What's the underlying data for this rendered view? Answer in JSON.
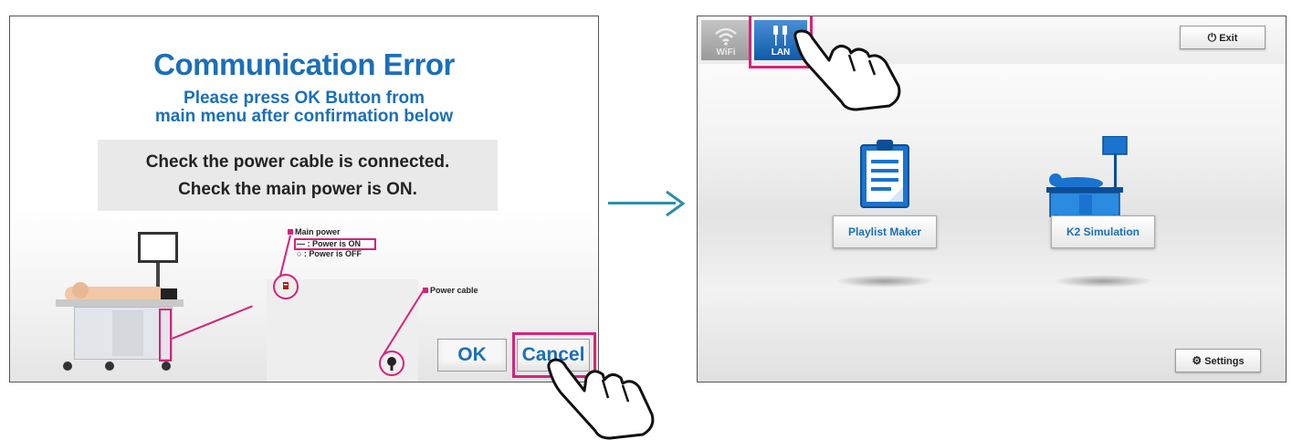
{
  "left": {
    "title": "Communication Error",
    "subtitle_line1": "Please press OK Button from",
    "subtitle_line2": "main menu after confirmation below",
    "check_power_cable": "Check the power cable is connected.",
    "check_main_power": "Check the main power is ON.",
    "main_power_label": "Main power",
    "power_on_label": "— : Power is ON",
    "power_off_label": "○ : Power is OFF",
    "power_cable_label": "Power cable",
    "ok_label": "OK",
    "cancel_label": "Cancel"
  },
  "right": {
    "wifi_tab_label": "WiFi",
    "lan_tab_label": "LAN",
    "exit_label": "Exit",
    "playlist_maker_label": "Playlist Maker",
    "k2_simulation_label": "K2 Simulation",
    "settings_label": "Settings"
  },
  "colors": {
    "accent_blue": "#1b6fb8",
    "highlight_pink": "#d6237a",
    "arrow_teal": "#2f8ea8"
  }
}
